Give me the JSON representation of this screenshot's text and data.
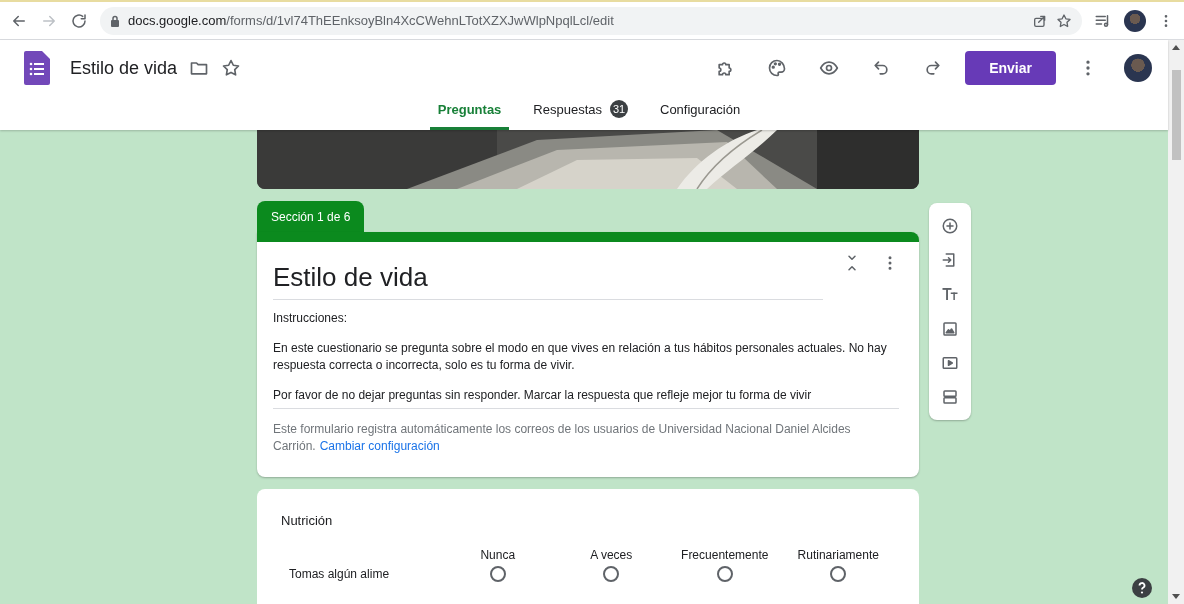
{
  "browser": {
    "url_host": "docs.google.com",
    "url_path": "/forms/d/1vl74ThEEnksoyBln4XcCWehnLTotXZXJwWlpNpqlLcl/edit"
  },
  "header": {
    "title": "Estilo de vida",
    "send_button": "Enviar"
  },
  "tabs": [
    {
      "label": "Preguntas",
      "selected": true
    },
    {
      "label": "Respuestas",
      "selected": false,
      "badge": "31"
    },
    {
      "label": "Configuración",
      "selected": false
    }
  ],
  "section": {
    "tab": "Sección 1 de 6",
    "title": "Estilo de vida",
    "description": [
      "Instrucciones:",
      "En este cuestionario se pregunta sobre el modo en que vives en relación a tus hábitos personales actuales. No hay respuesta correcta o incorrecta, solo es tu forma de vivir.",
      "Por favor de no dejar preguntas sin responder. Marcar la respuesta que refleje mejor tu forma de vivir"
    ],
    "notice": "Este formulario registra automáticamente los correos de los usuarios de Universidad Nacional Daniel Alcides Carrión.",
    "notice_link": "Cambiar configuración"
  },
  "question": {
    "title": "Nutrición",
    "columns": [
      "Nunca",
      "A veces",
      "Frecuentemente",
      "Rutinariamente"
    ],
    "rows": [
      {
        "label": "Tomas algún alime",
        "choices": [
          false,
          false,
          false,
          false
        ]
      }
    ]
  }
}
